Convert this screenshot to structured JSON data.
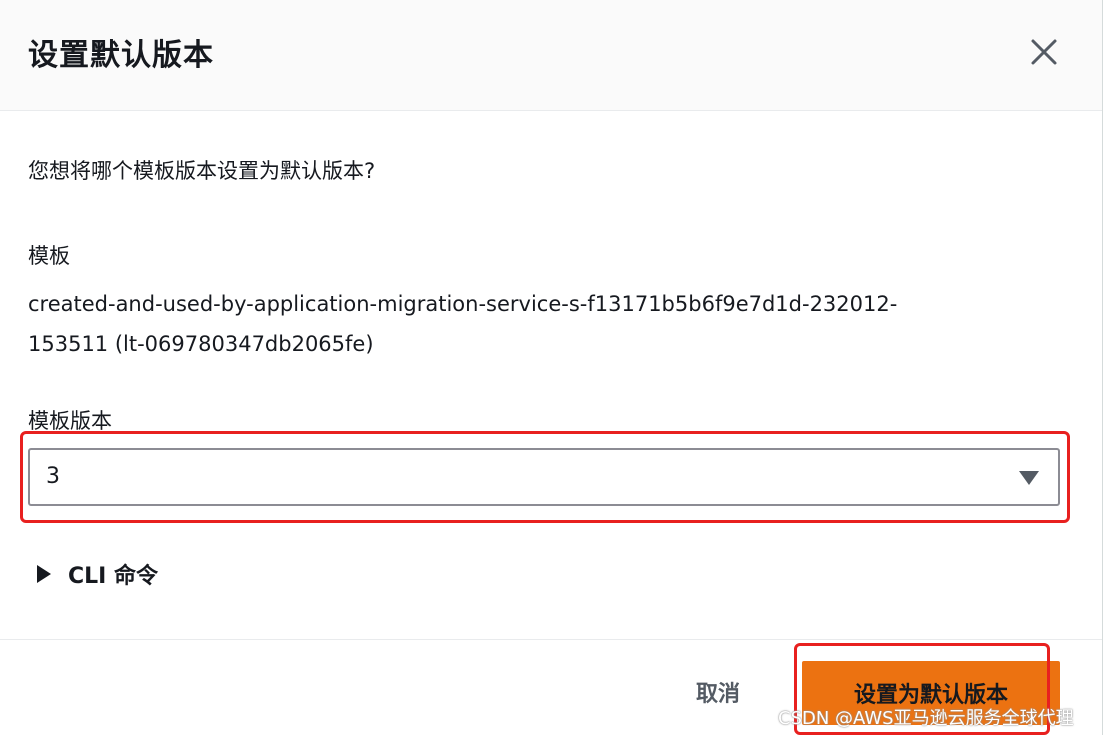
{
  "modal": {
    "title": "设置默认版本",
    "close_icon": "close-icon",
    "question": "您想将哪个模板版本设置为默认版本?",
    "template_label": "模板",
    "template_value_line1": "created-and-used-by-application-migration-service-s-f13171b5b6f9e7d1d-232012-",
    "template_value_line2": "153511 (lt-069780347db2065fe)",
    "version_label": "模板版本",
    "version_select": {
      "selected": "3",
      "caret_icon": "caret-down-icon"
    },
    "cli_toggle": {
      "icon": "caret-right-icon",
      "label": "CLI 命令"
    }
  },
  "footer": {
    "cancel_label": "取消",
    "confirm_label": "设置为默认版本"
  },
  "annotations": {
    "highlight_color": "#e8201f"
  },
  "watermark": "CSDN @AWS亚马逊云服务全球代理",
  "colors": {
    "primary_button": "#ec7211",
    "header_bg": "#fafafa",
    "text": "#16191f"
  }
}
